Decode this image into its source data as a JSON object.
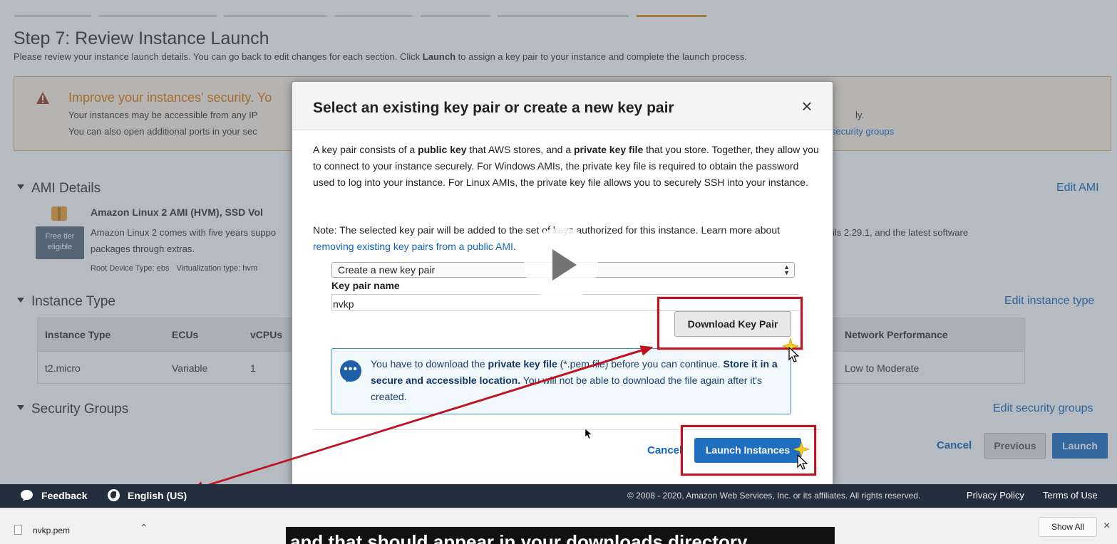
{
  "page": {
    "step_title": "Step 7: Review Instance Launch",
    "step_desc_prefix": "Please review your instance launch details. You can go back to edit changes for each section. Click ",
    "step_desc_bold": "Launch",
    "step_desc_suffix": " to assign a key pair to your instance and complete the launch process."
  },
  "warning": {
    "title": "Improve your instances' security. Yo",
    "line1": "Your instances may be accessible from any IP",
    "line2": "You can also open additional ports in your sec",
    "line1_right": "ly.",
    "line2_right": "security groups"
  },
  "ami": {
    "heading": "AMI Details",
    "edit": "Edit AMI",
    "name": "Amazon Linux 2 AMI (HVM), SSD Vol",
    "free_tier": "Free tier eligible",
    "desc1": "Amazon Linux 2 comes with five years suppo",
    "desc2": "packages through extras.",
    "desc_right": "ils 2.29.1, and the latest software",
    "root_device": "Root Device Type: ebs",
    "virt_type": "Virtualization type: hvm"
  },
  "instance_type": {
    "heading": "Instance Type",
    "edit": "Edit instance type",
    "columns": [
      "Instance Type",
      "ECUs",
      "vCPUs",
      "Network Performance"
    ],
    "row": [
      "t2.micro",
      "Variable",
      "1",
      "Low to Moderate"
    ]
  },
  "security_groups": {
    "heading": "Security Groups",
    "edit": "Edit security groups"
  },
  "bottom_buttons": {
    "cancel": "Cancel",
    "previous": "Previous",
    "launch": "Launch"
  },
  "modal": {
    "title": "Select an existing key pair or create a new key pair",
    "close": "×",
    "p1_a": "A key pair consists of a ",
    "p1_b": "public key",
    "p1_c": " that AWS stores, and a ",
    "p1_d": "private key file",
    "p1_e": " that you store. Together, they allow you to connect to your instance securely. For Windows AMIs, the private key file is required to obtain the password used to log into your instance. For Linux AMIs, the private key file allows you to securely SSH into your instance.",
    "p2_a": "Note: The selected key pair will be added to the set of keys authorized for this instance. Learn more about ",
    "p2_link": "removing existing key pairs from a public AMI",
    "p2_b": ".",
    "select_value": "Create a new key pair",
    "key_pair_label": "Key pair name",
    "key_pair_value": "nvkp",
    "download_button": "Download Key Pair",
    "info_a": "You have to download the ",
    "info_b": "private key file",
    "info_c": " (*.pem file) before you can continue. ",
    "info_d": "Store it in a secure and accessible location.",
    "info_e": " You will not be able to download the file again after it's created.",
    "cancel": "Cancel",
    "launch_instances": "Launch Instances"
  },
  "footer": {
    "feedback": "Feedback",
    "language": "English (US)",
    "copyright": "© 2008 - 2020, Amazon Web Services, Inc. or its affiliates. All rights reserved.",
    "privacy": "Privacy Policy",
    "terms": "Terms of Use"
  },
  "downloads": {
    "file_name": "nvkp.pem",
    "show_all": "Show All",
    "close": "×"
  },
  "caption": {
    "text": "and that should appear in your downloads directory"
  },
  "colors": {
    "highlight": "#c1121f",
    "aws_blue": "#1f6fc0",
    "footer_bg": "#232f3e",
    "warning_orange": "#e07b00"
  }
}
